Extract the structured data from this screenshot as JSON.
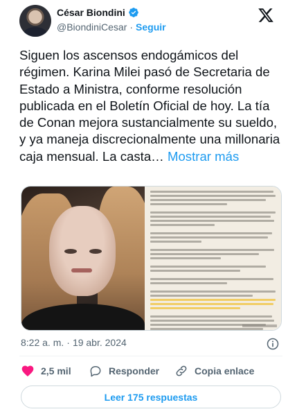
{
  "author": {
    "name": "César Biondini",
    "handle": "@BiondiniCesar",
    "separator": "·",
    "follow_label": "Seguir",
    "verified": true
  },
  "tweet": {
    "text": "Siguen los ascensos endogámicos del régimen. Karina Milei pasó de Secretaria de Estado a Ministra, conforme resolución publicada en el Boletín Oficial de hoy. La tía de Conan mejora sustancialmente su sueldo, y ya maneja discrecionalmente una millonaria caja mensual. La casta…",
    "more_label": "Mostrar más"
  },
  "meta": {
    "time": "8:22 a. m.",
    "separator": "·",
    "date": "19 abr. 2024"
  },
  "actions": {
    "likes": "2,5 mil",
    "reply_label": "Responder",
    "copy_link_label": "Copia enlace"
  },
  "replies_button": "Leer 175 respuestas",
  "colors": {
    "accent": "#1d9bf0",
    "like_red": "#f91880",
    "secondary_text": "#536471"
  },
  "icons": [
    "verified-badge-icon",
    "x-logo-icon",
    "info-icon",
    "heart-icon",
    "reply-icon",
    "link-icon"
  ]
}
